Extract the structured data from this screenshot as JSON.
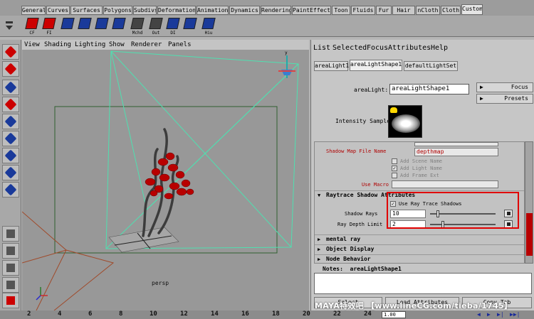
{
  "shelf_tabs": [
    "General",
    "Curves",
    "Surfaces",
    "Polygons",
    "Subdivs",
    "Deformation",
    "Animation",
    "Dynamics",
    "Rendering",
    "PaintEffects",
    "Toon",
    "Fluids",
    "Fur",
    "Hair",
    "nCloth",
    "Cloth",
    "Custom"
  ],
  "active_shelf_tab": "Custom",
  "shelf_buttons": [
    {
      "icon": "cf-icon",
      "label": "CF"
    },
    {
      "icon": "fi-icon",
      "label": "FI"
    },
    {
      "icon": "uv-grid-icon",
      "label": ""
    },
    {
      "icon": "select-grid-icon",
      "label": ""
    },
    {
      "icon": "grid-select-icon",
      "label": ""
    },
    {
      "icon": "move-grid-icon",
      "label": ""
    },
    {
      "icon": "mchd-icon",
      "label": "Mchd"
    },
    {
      "icon": "out-icon",
      "label": "Out"
    },
    {
      "icon": "di-icon",
      "label": "DI"
    },
    {
      "icon": "shader-icon",
      "label": ""
    },
    {
      "icon": "hik-icon",
      "label": "Hiu"
    }
  ],
  "viewport": {
    "menu": [
      "View",
      "Shading",
      "Lighting",
      "Show",
      "Renderer",
      "Panels"
    ],
    "camera_label": "persp",
    "axis_labels": {
      "y": "y",
      "x": "x",
      "z": "z"
    }
  },
  "attribute_editor": {
    "menu": [
      "List",
      "Selected",
      "Focus",
      "Attributes",
      "Help"
    ],
    "tabs": [
      "areaLight1",
      "areaLightShape1",
      "defaultLightSet"
    ],
    "active_tab": "areaLightShape1",
    "node_type_label": "areaLight:",
    "node_name": "areaLightShape1",
    "focus_label": "Focus",
    "presets_label": "Presets",
    "intensity_sample_label": "Intensity Sample",
    "shadow_map_file_name_label": "Shadow Map File Name",
    "shadow_map_file_name_value": "depthmap",
    "add_scene_name": {
      "label": "Add Scene Name",
      "checked": false
    },
    "add_light_name": {
      "label": "Add Light Name",
      "checked": true
    },
    "add_frame_ext": {
      "label": "Add Frame Ext",
      "checked": false
    },
    "use_macro_label": "Use Macro",
    "raytrace_section": "Raytrace Shadow Attributes",
    "use_ray_trace_shadows": {
      "label": "Use Ray Trace Shadows",
      "checked": true
    },
    "shadow_rays": {
      "label": "Shadow Rays",
      "value": "10",
      "fraction": 0.1
    },
    "ray_depth_limit": {
      "label": "Ray Depth Limit",
      "value": "2",
      "fraction": 0.18
    },
    "collapsed_sections": [
      "mental ray",
      "Object Display",
      "Node Behavior"
    ],
    "notes_label": "Notes:",
    "notes_node": "areaLightShape1",
    "bottom_buttons": [
      "Select",
      "Load Attributes",
      "Copy Tab"
    ]
  },
  "timeline": {
    "ticks": [
      "2",
      "4",
      "6",
      "8",
      "10",
      "12",
      "14",
      "16",
      "18",
      "20",
      "22",
      "24"
    ],
    "current_frame": "1.00"
  },
  "watermark": "MAYA特效吧 【www.lineCG.com/tieba/1745】",
  "colors": {
    "viewport_bg": "#989898",
    "light_wire": "#4fe0b0",
    "highlight": "#e00000",
    "berry": "#b80000"
  }
}
